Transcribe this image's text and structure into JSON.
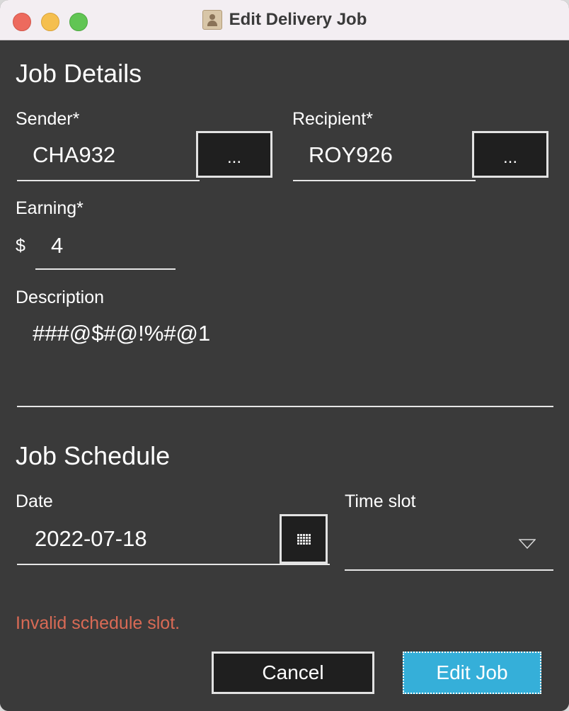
{
  "window": {
    "title": "Edit Delivery Job",
    "app_icon": "contact-card-icon"
  },
  "job_details": {
    "heading": "Job Details",
    "sender": {
      "label": "Sender*",
      "value": "CHA932",
      "picker_label": "..."
    },
    "recipient": {
      "label": "Recipient*",
      "value": "ROY926",
      "picker_label": "..."
    },
    "earning": {
      "label": "Earning*",
      "currency": "$",
      "value": "4"
    },
    "description": {
      "label": "Description",
      "value": "###@$#@!%#@1"
    }
  },
  "job_schedule": {
    "heading": "Job Schedule",
    "date": {
      "label": "Date",
      "value": "2022-07-18",
      "picker_icon": "calendar-icon"
    },
    "time_slot": {
      "label": "Time slot",
      "value": "",
      "dropdown_icon": "chevron-down-icon"
    }
  },
  "error_message": "Invalid schedule slot.",
  "buttons": {
    "cancel": "Cancel",
    "edit": "Edit Job"
  },
  "colors": {
    "background": "#3a3a3a",
    "titlebar": "#f3eef2",
    "error": "#d96a55",
    "accent": "#35afd9",
    "button_dark": "#1f1f1f"
  }
}
